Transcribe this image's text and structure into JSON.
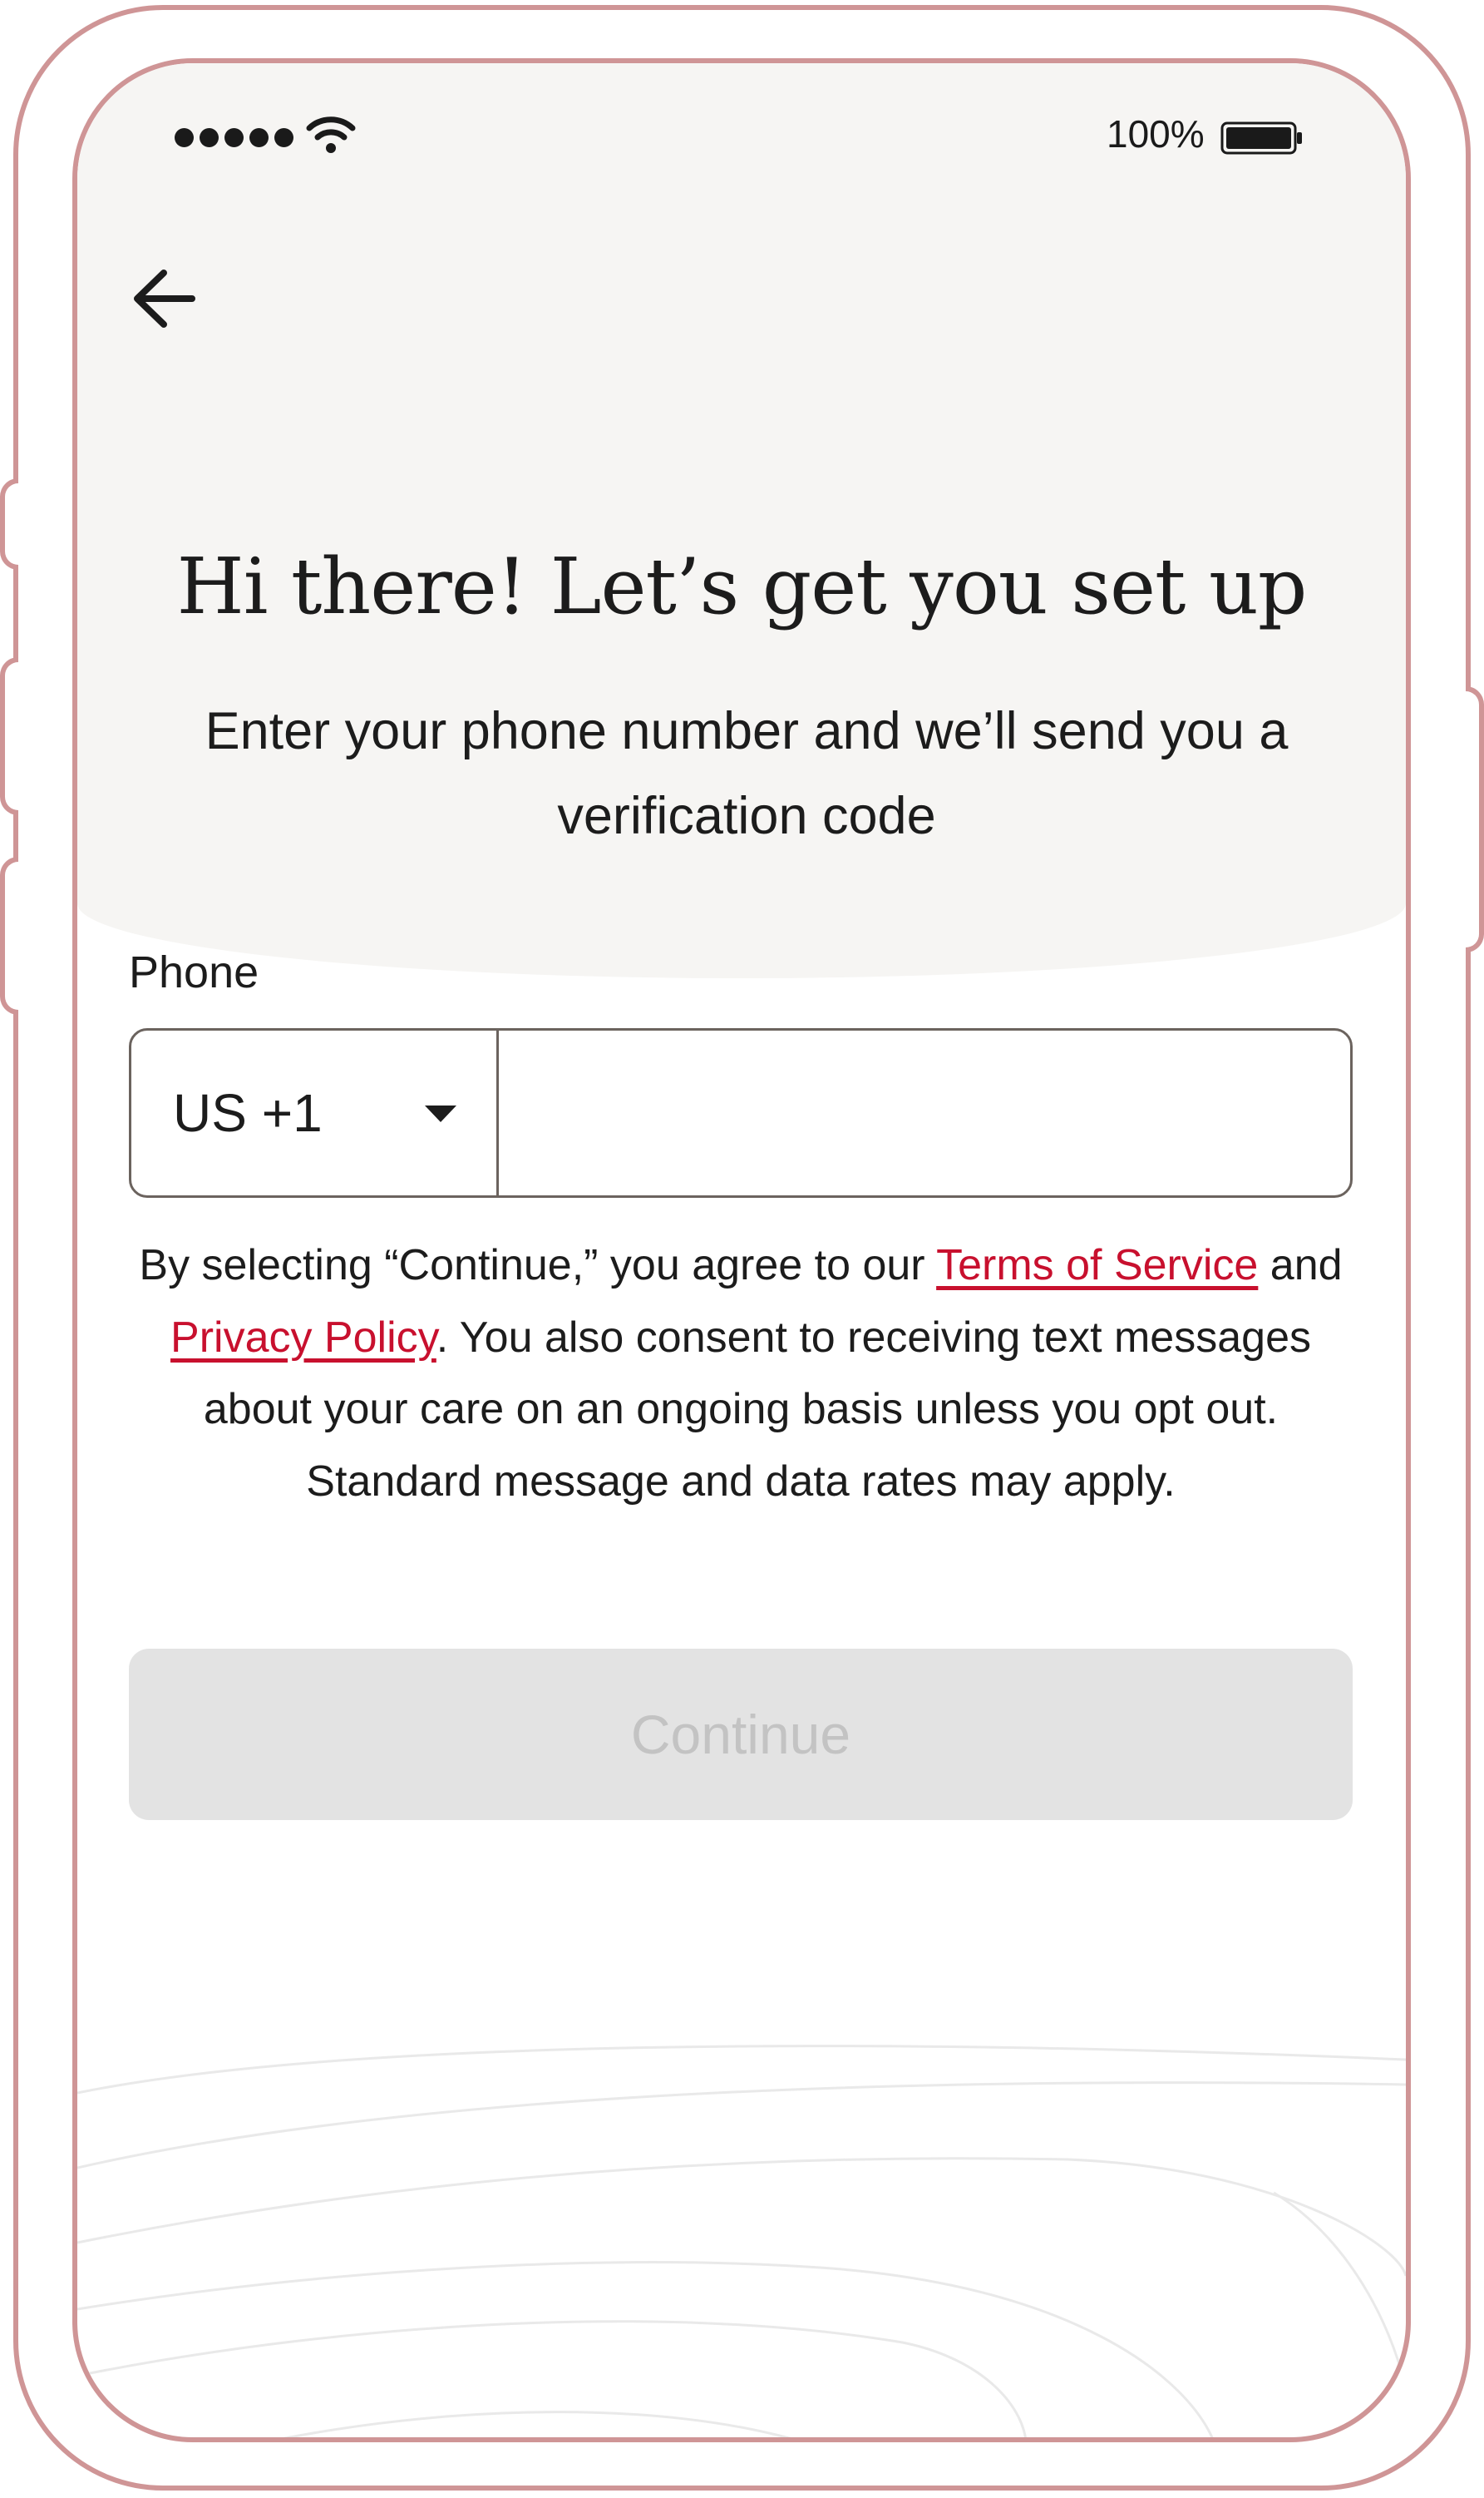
{
  "status_bar": {
    "battery_percent": "100%",
    "signal_dots": 5,
    "icons": [
      "signal-dots-icon",
      "wifi-icon",
      "battery-icon"
    ]
  },
  "nav": {
    "back_icon": "arrow-left-icon"
  },
  "header": {
    "title": "Hi there! Let’s get you set up",
    "subtitle": "Enter your phone number and we’ll send you a verification code"
  },
  "form": {
    "phone_label": "Phone",
    "country_code": "US +1",
    "phone_value": "",
    "caret_icon": "caret-down-icon"
  },
  "legal": {
    "prefix": "By selecting “Continue,” you agree to our ",
    "terms_link": "Terms of Service",
    "middle": " and ",
    "privacy_link": "Privacy Policy",
    "suffix": ". You also consent to receiving text messages about your care on an ongoing basis unless you opt out. Standard message and data rates may apply."
  },
  "actions": {
    "continue_label": "Continue",
    "continue_disabled": true
  },
  "colors": {
    "frame": "#cf9596",
    "link": "#c8102e",
    "header_bg": "#f6f5f3",
    "button_disabled_bg": "#e3e3e3",
    "button_disabled_text": "#c3c3c3"
  }
}
